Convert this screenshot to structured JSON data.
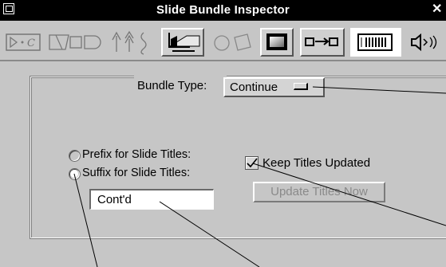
{
  "window": {
    "title": "Slide Bundle Inspector",
    "close_glyph": "✕"
  },
  "toolbar": {
    "items": [
      {
        "name": "slide-transition-icon",
        "text": "▷·C"
      },
      {
        "name": "shape-inspector-icon"
      },
      {
        "name": "arrows-inspector-icon"
      },
      {
        "name": "graphics-inspector-icon"
      },
      {
        "name": "shapes-inspector-icon"
      },
      {
        "name": "fill-inspector-icon"
      },
      {
        "name": "connection-inspector-icon"
      },
      {
        "name": "bundle-inspector-icon",
        "selected": true
      },
      {
        "name": "sound-inspector-icon"
      }
    ]
  },
  "bundle_type": {
    "label": "Bundle Type:",
    "value": "Continue"
  },
  "title_options": {
    "prefix_label": "Prefix for Slide Titles:",
    "suffix_label": "Suffix for Slide Titles:",
    "selected": "suffix",
    "suffix_value": "Cont'd"
  },
  "keep_updated": {
    "label": "Keep Titles Updated",
    "checked": true
  },
  "update_button": {
    "label": "Update Titles Now",
    "enabled": false
  }
}
